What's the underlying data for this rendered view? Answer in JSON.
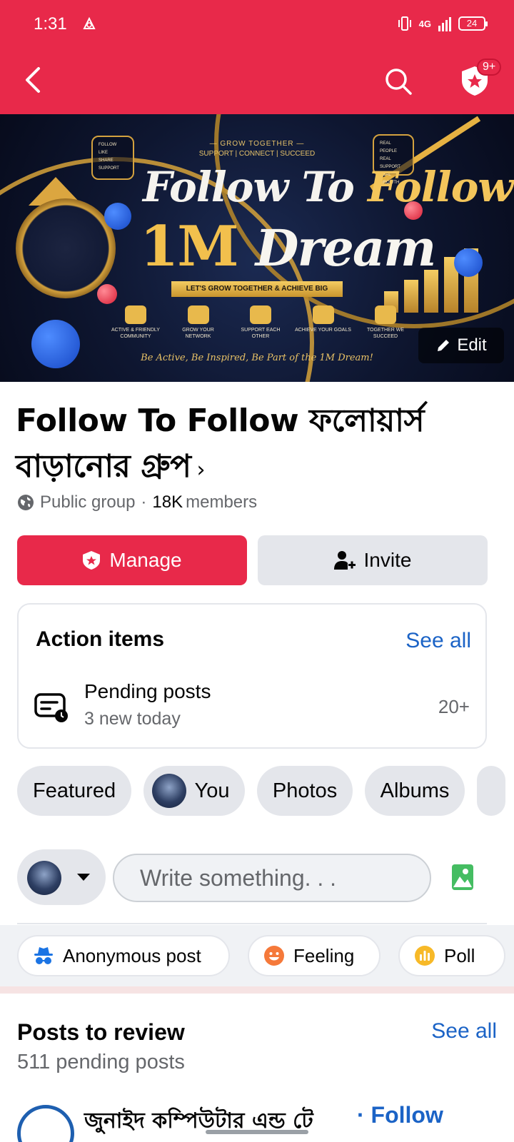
{
  "status_bar": {
    "time": "1:31",
    "network": "4G",
    "battery": "24"
  },
  "header": {
    "notification_badge": "9+"
  },
  "cover": {
    "top_line": "— GROW TOGETHER —",
    "top_sub": "SUPPORT | CONNECT | SUCCEED",
    "title_line1_a": "Follow To ",
    "title_line1_b": "Follow",
    "title_line2_a": "1M ",
    "title_line2_b": "Dream",
    "ribbon": "LET'S GROW TOGETHER & ACHIEVE BIG",
    "left_box": [
      "FOLLOW",
      "LIKE",
      "SHARE",
      "SUPPORT"
    ],
    "right_box": [
      "REAL PEOPLE",
      "REAL SUPPORT",
      "REAL GROWTH"
    ],
    "features": [
      "ACTIVE & FRIENDLY COMMUNITY",
      "GROW YOUR NETWORK",
      "SUPPORT EACH OTHER",
      "ACHIEVE YOUR GOALS",
      "TOGETHER WE SUCCEED"
    ],
    "tagline": "Be Active, Be Inspired, Be Part of the 1M Dream!",
    "edit_label": "Edit"
  },
  "group": {
    "name": "Follow To Follow ফলোয়ার্স বাড়ানোর গ্রুপ",
    "privacy": "Public group",
    "separator": "·",
    "member_count": "18K",
    "members_label": "members"
  },
  "buttons": {
    "manage": "Manage",
    "invite": "Invite"
  },
  "action_items": {
    "title": "Action items",
    "see_all": "See all",
    "pending_title": "Pending posts",
    "pending_sub": "3 new today",
    "pending_count": "20+"
  },
  "chips": [
    "Featured",
    "You",
    "Photos",
    "Albums"
  ],
  "composer": {
    "placeholder": "Write something. . ."
  },
  "post_options": [
    "Anonymous post",
    "Feeling",
    "Poll"
  ],
  "review": {
    "title": "Posts to review",
    "see_all": "See all",
    "subtitle": "511 pending posts",
    "first_author": "জুনাইদ কম্পিউটার এন্ড টে",
    "first_follow": "· Follow"
  },
  "colors": {
    "brand": "#e8294a",
    "link": "#1b63c6",
    "chip_bg": "#e4e6eb"
  }
}
